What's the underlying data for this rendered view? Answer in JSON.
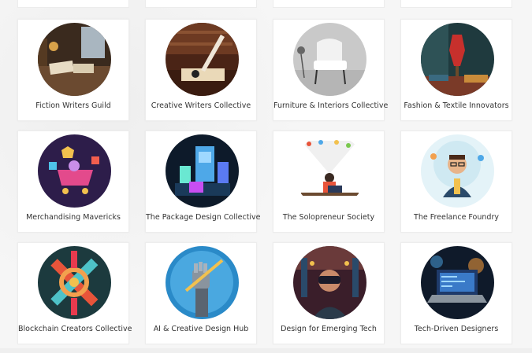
{
  "groups": [
    {
      "label": "Fiction Writers Guild",
      "icon": "writing-desk-image"
    },
    {
      "label": "Creative Writers Collective",
      "icon": "quill-pen-image"
    },
    {
      "label": "Furniture & Interiors Collective",
      "icon": "armchair-image"
    },
    {
      "label": "Fashion & Textile Innovators",
      "icon": "dress-form-image"
    },
    {
      "label": "Merchandising Mavericks",
      "icon": "shopping-cart-image"
    },
    {
      "label": "The Package Design Collective",
      "icon": "packaging-image"
    },
    {
      "label": "The Solopreneur Society",
      "icon": "laptop-worker-image"
    },
    {
      "label": "The Freelance Foundry",
      "icon": "freelancer-avatar-image"
    },
    {
      "label": "Blockchain Creators Collective",
      "icon": "blockchain-knot-image"
    },
    {
      "label": "AI & Creative Design Hub",
      "icon": "robot-hand-pencil-image"
    },
    {
      "label": "Design for Emerging Tech",
      "icon": "vr-headset-image"
    },
    {
      "label": "Tech-Driven Designers",
      "icon": "laptop-code-image"
    }
  ]
}
